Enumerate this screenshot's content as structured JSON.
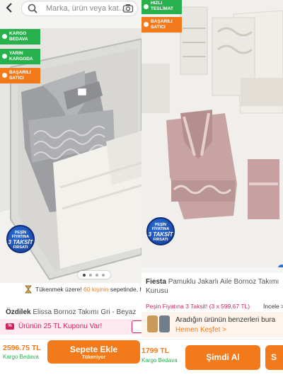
{
  "left": {
    "search": {
      "placeholder": "Marka, ürün veya kat…"
    },
    "badges": [
      {
        "label": "KARGO BEDAVA"
      },
      {
        "label": "YARIN KARGODA"
      },
      {
        "label": "BAŞARILI SATICI"
      }
    ],
    "promo_badge": {
      "line1": "PEŞİN",
      "line2": "FİYATINA",
      "line3": "3 TAKSİT",
      "line4": "FIRSATI"
    },
    "carousel": {
      "dots": 4,
      "active": 1
    },
    "stock_notice": {
      "text": "Tükenmek üzere!",
      "highlight": "60 kişinin",
      "rest": "sepetinde, he"
    },
    "product": {
      "brand": "Özdilek",
      "name": "Elissa Bornoz Takımı Gri - Beyaz"
    },
    "coupon": {
      "text": "Ürünün 25 TL Kuponu Var!",
      "icon": "coupon-icon"
    },
    "price": {
      "value": "2596.75 TL",
      "shipping": "Kargo Bedava"
    },
    "add_to_cart": {
      "label": "Sepete Ekle",
      "sub": "Tükeniyor"
    }
  },
  "right": {
    "badges": [
      {
        "label": "HIZLI TESLİMAT"
      },
      {
        "label": "BAŞARILI SATICI"
      }
    ],
    "promo_badge": {
      "line1": "PEŞİN",
      "line2": "FİYATINA",
      "line3": "3 TAKSİT",
      "line4": "FIRSATI"
    },
    "product": {
      "brand": "Fiesta",
      "name": "Pamuklu Jakarlı Aile Bornoz Takımı",
      "name2": "Kurusu"
    },
    "installment": {
      "text": "Peşin Fiyatına 3 Taksit! (3 x 599,67 TL)",
      "link": "İncele >"
    },
    "similar": {
      "title": "Aradığın ürünün benzerleri bura",
      "link": "Hemen Keşfet >"
    },
    "price": {
      "value": "1799 TL",
      "shipping": "Kargo Bedava"
    },
    "buy_now": {
      "label": "Şimdi Al"
    },
    "next_button": {
      "label": "S"
    }
  },
  "colors": {
    "orange": "#f27a1a",
    "green": "#27b04b",
    "pink_text": "#d2245a"
  }
}
